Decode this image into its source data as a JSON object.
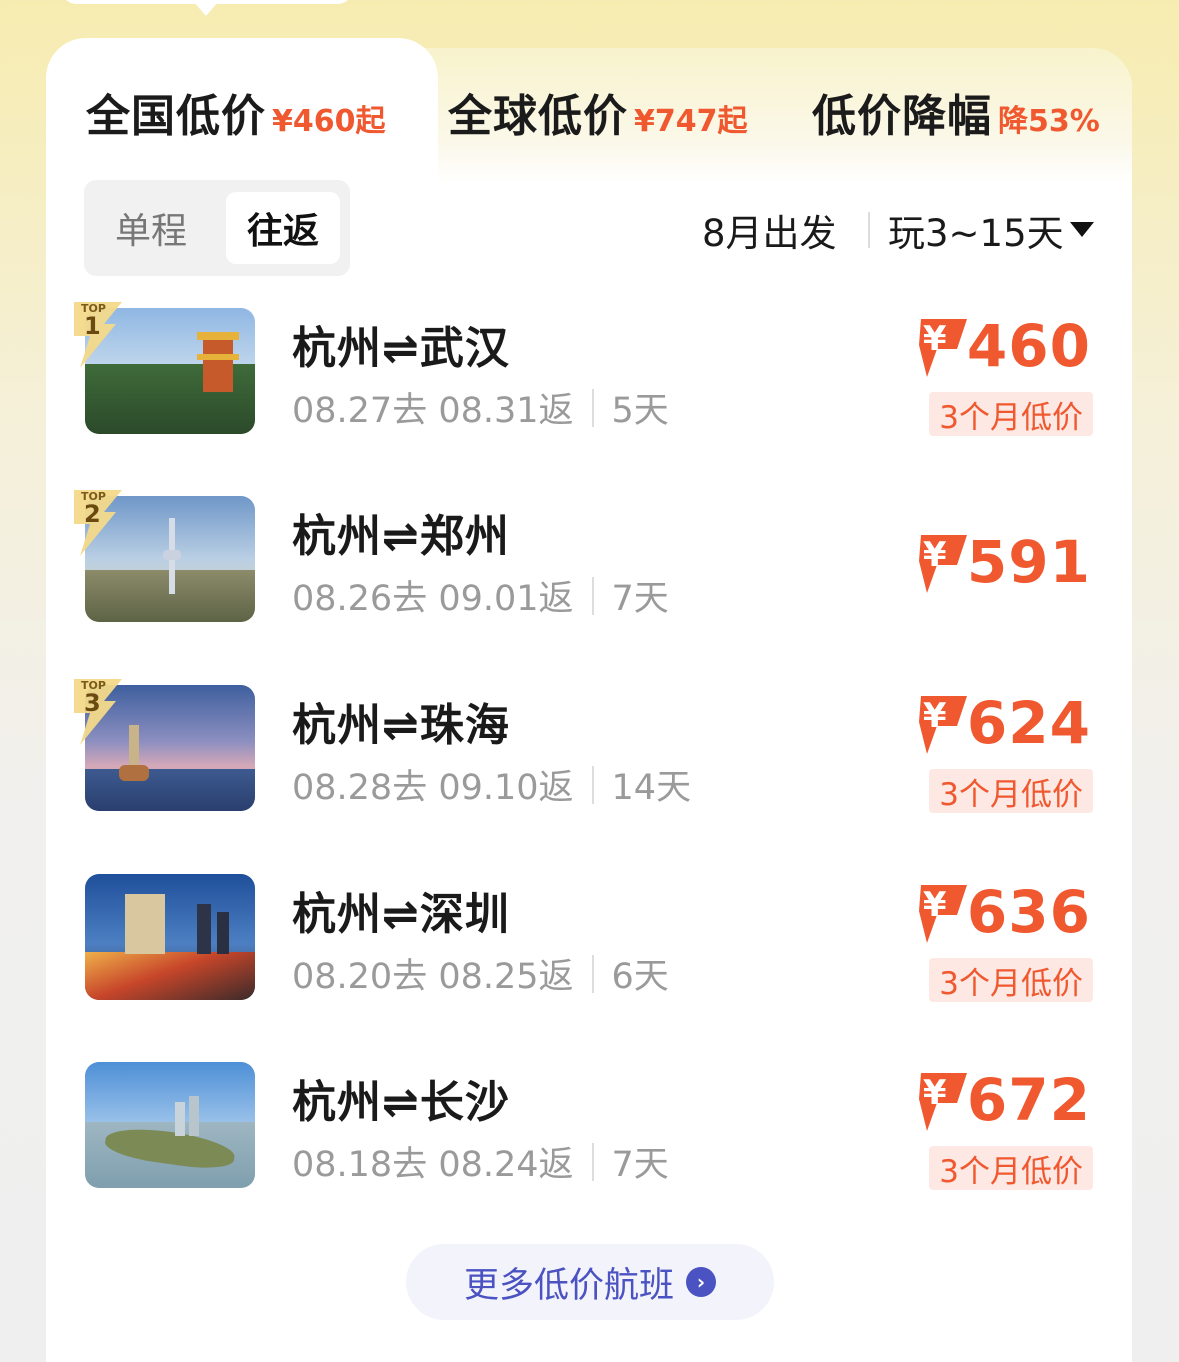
{
  "tabs": [
    {
      "label": "全国低价",
      "sub": "¥460起"
    },
    {
      "label": "全球低价",
      "sub": "¥747起"
    },
    {
      "label": "低价降幅",
      "sub": "降53%"
    }
  ],
  "trip_type": {
    "one_way": "单程",
    "round_trip": "往返"
  },
  "filters": {
    "month": "8月出发",
    "duration": "玩3~15天"
  },
  "badge_top": "TOP",
  "currency_symbol": "¥",
  "routes": [
    {
      "rank": "1",
      "route": "杭州⇌武汉",
      "dates": "08.27去 08.31返",
      "days": "5天",
      "price": "460",
      "tag": "3个月低价"
    },
    {
      "rank": "2",
      "route": "杭州⇌郑州",
      "dates": "08.26去 09.01返",
      "days": "7天",
      "price": "591",
      "tag": ""
    },
    {
      "rank": "3",
      "route": "杭州⇌珠海",
      "dates": "08.28去 09.10返",
      "days": "14天",
      "price": "624",
      "tag": "3个月低价"
    },
    {
      "rank": "",
      "route": "杭州⇌深圳",
      "dates": "08.20去 08.25返",
      "days": "6天",
      "price": "636",
      "tag": "3个月低价"
    },
    {
      "rank": "",
      "route": "杭州⇌长沙",
      "dates": "08.18去 08.24返",
      "days": "7天",
      "price": "672",
      "tag": "3个月低价"
    }
  ],
  "more_button": "更多低价航班",
  "colors": {
    "accent": "#f0582f",
    "link": "#4b52c2",
    "tag_bg": "#fde8e3"
  }
}
